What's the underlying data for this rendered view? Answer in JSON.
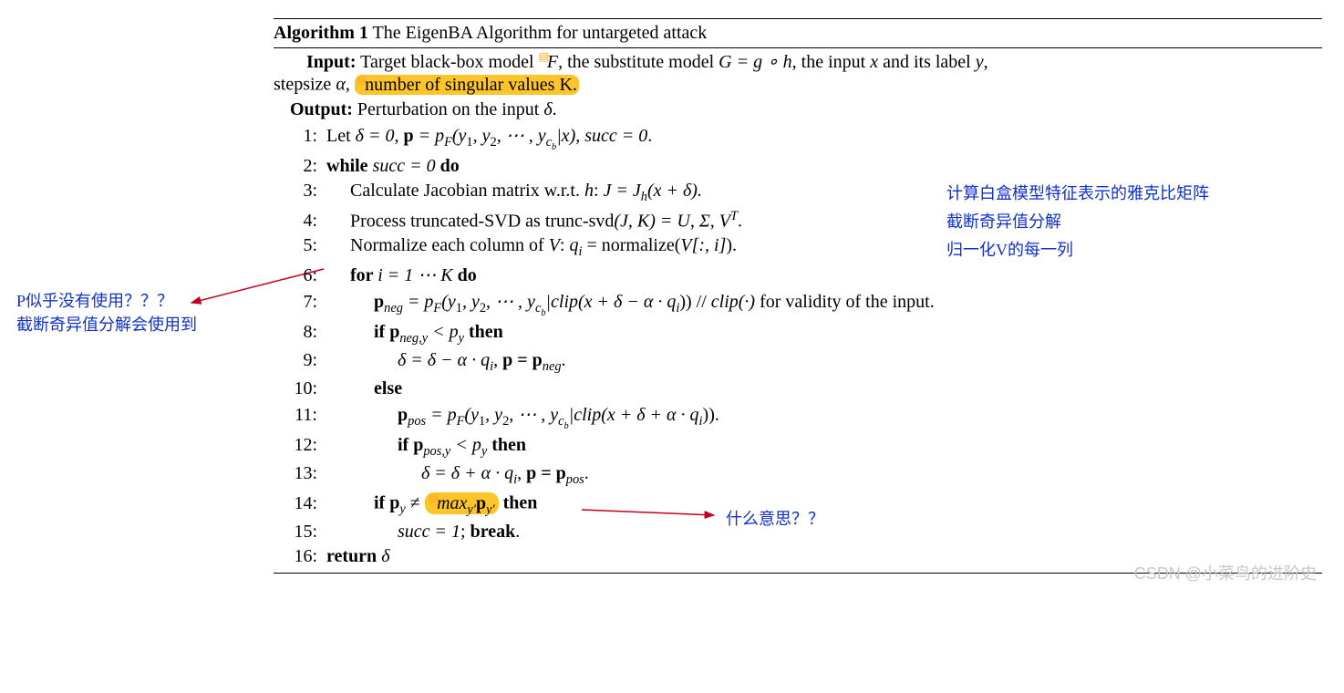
{
  "title_prefix": "Algorithm 1",
  "title_rest": " The EigenBA Algorithm for untargeted attack",
  "input_label": "Input:",
  "input_text_1": "Target black-box model ",
  "input_F": "F",
  "input_text_2": ", the substitute model ",
  "input_G": "G = g ∘ h",
  "input_text_3": ", the input ",
  "input_x": "x",
  "input_text_4": " and its label ",
  "input_y": "y",
  "input_text_5": ",",
  "input_line2_1": "stepsize ",
  "input_alpha": "α",
  "input_line2_2": ", ",
  "input_hl": "number of singular values K.",
  "output_label": "Output:",
  "output_text": " Perturbation on the input ",
  "output_delta": "δ",
  "output_period": ".",
  "lines": {
    "l1": {
      "no": "1:",
      "a": "Let ",
      "b": "δ = 0",
      "c": ", ",
      "d": "p",
      "e": " = p",
      "f": "F",
      "g": "(y",
      "h": "1",
      "i": ", y",
      "j": "2",
      "k": ", ⋯ , y",
      "l": "c",
      "m": "b",
      "n": "|x), ",
      "o": "succ = 0",
      "p": "."
    },
    "l2": {
      "no": "2:",
      "a": "while ",
      "b": "succ = 0",
      "c": " do"
    },
    "l3": {
      "no": "3:",
      "a": "Calculate Jacobian matrix w.r.t. ",
      "b": "h",
      "c": ": ",
      "d": "J = J",
      "e": "h",
      "f": "(x + δ)."
    },
    "l4": {
      "no": "4:",
      "a": "Process truncated-SVD as trunc-svd",
      "b": "(J, K) = U, Σ, V",
      "c": "T",
      "d": "."
    },
    "l5": {
      "no": "5:",
      "a": "Normalize each column of ",
      "b": "V",
      "c": ": ",
      "d": "q",
      "e": "i",
      "f": " = normalize(",
      "g": "V[:, i]",
      "h": ")."
    },
    "l6": {
      "no": "6:",
      "a": "for ",
      "b": "i = 1 ⋯ K",
      "c": " do"
    },
    "l7": {
      "no": "7:",
      "a": "p",
      "b": "neg",
      "c": " = p",
      "d": "F",
      "e": "(y",
      "f": "1",
      "g": ", y",
      "h": "2",
      "i": ", ⋯ , y",
      "j": "c",
      "k": "b",
      "l": "|clip(x + δ − α · q",
      "m": "i",
      "n": ")) // ",
      "o": "clip(·)",
      "p": " for validity of the input."
    },
    "l8": {
      "no": "8:",
      "a": "if ",
      "b": "p",
      "c": "neg,y",
      "d": " < p",
      "e": "y",
      "f": " then"
    },
    "l9": {
      "no": "9:",
      "a": "δ = δ − α · q",
      "b": "i",
      "c": ", ",
      "d": "p = p",
      "e": "neg",
      "f": "."
    },
    "l10": {
      "no": "10:",
      "a": "else"
    },
    "l11": {
      "no": "11:",
      "a": "p",
      "b": "pos",
      "c": " = p",
      "d": "F",
      "e": "(y",
      "f": "1",
      "g": ", y",
      "h": "2",
      "i": ", ⋯ , y",
      "j": "c",
      "k": "b",
      "l": "|clip(x + δ + α · q",
      "m": "i",
      "n": "))."
    },
    "l12": {
      "no": "12:",
      "a": "if ",
      "b": "p",
      "c": "pos,y",
      "d": " < p",
      "e": "y",
      "f": " then"
    },
    "l13": {
      "no": "13:",
      "a": "δ = δ + α · q",
      "b": "i",
      "c": ", ",
      "d": "p = p",
      "e": "pos",
      "f": "."
    },
    "l14": {
      "no": "14:",
      "a": "if ",
      "b": "p",
      "c": "y",
      "d": " ≠ ",
      "e": "max",
      "f": "y′",
      "g": "p",
      "h": "y′",
      "i": " then"
    },
    "l15": {
      "no": "15:",
      "a": "succ = 1",
      "b": "; ",
      "c": "break",
      "d": "."
    },
    "l16": {
      "no": "16:",
      "a": "return ",
      "b": "δ"
    }
  },
  "annotations": {
    "left1": "P似乎没有使用？？？",
    "left2": "截断奇异值分解会使用到",
    "r3": "计算白盒模型特征表示的雅克比矩阵",
    "r4": "截断奇异值分解",
    "r5": "归一化V的每一列",
    "r14": "什么意思？？"
  },
  "watermark": "CSDN @小菜鸟的进阶史"
}
